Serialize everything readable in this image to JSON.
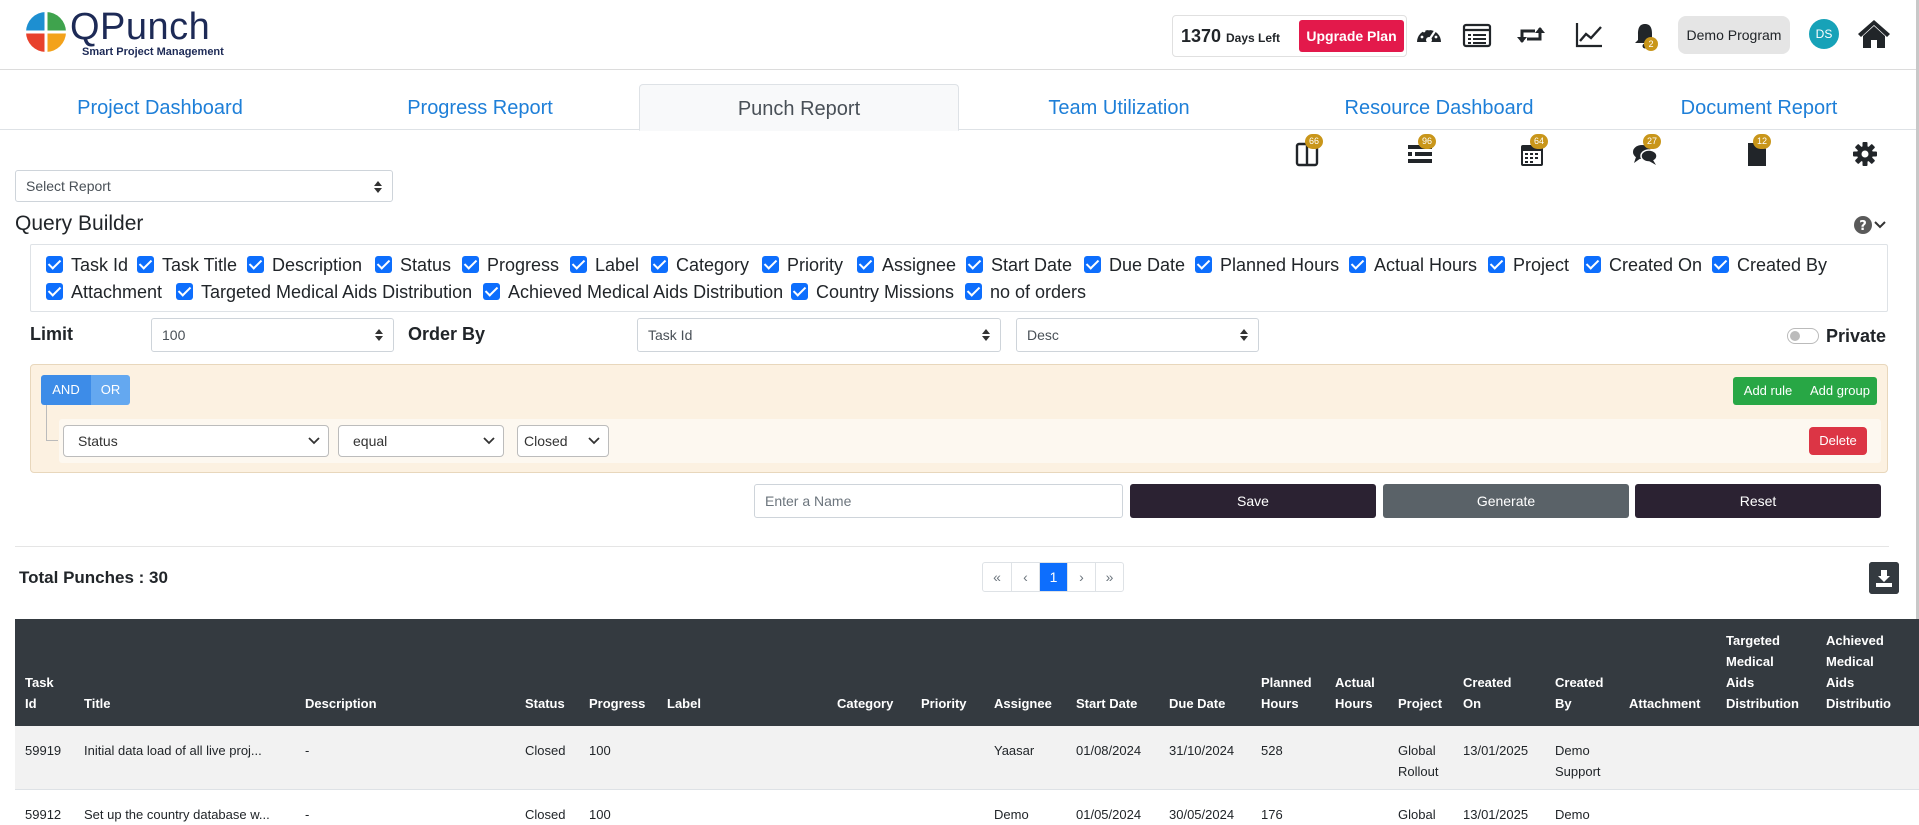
{
  "brand": {
    "name": "QPunch",
    "tagline": "Smart Project Management"
  },
  "header": {
    "days_left_num": "1370",
    "days_left_label": "Days Left",
    "upgrade_label": "Upgrade Plan",
    "notification_count": "2",
    "program_label": "Demo Program",
    "avatar_initials": "DS",
    "icons": [
      "dashboard-gauge-icon",
      "list-icon",
      "retweet-icon",
      "line-chart-icon",
      "bell-icon",
      "home-icon"
    ]
  },
  "tabs": [
    {
      "label": "Project Dashboard",
      "active": false
    },
    {
      "label": "Progress Report",
      "active": false
    },
    {
      "label": "Punch Report",
      "active": true
    },
    {
      "label": "Team Utilization",
      "active": false
    },
    {
      "label": "Resource Dashboard",
      "active": false
    },
    {
      "label": "Document Report",
      "active": false
    }
  ],
  "toolbar": {
    "badges": [
      "66",
      "96",
      "64",
      "27",
      "12"
    ],
    "icons": [
      "columns-icon",
      "stacked-list-icon",
      "calendar-icon",
      "comments-icon",
      "file-icon",
      "gear-icon"
    ]
  },
  "select_report": {
    "value": "Select Report"
  },
  "query_builder": {
    "title": "Query Builder",
    "fields": [
      "Task Id",
      "Task Title",
      "Description",
      "Status",
      "Progress",
      "Label",
      "Category",
      "Priority",
      "Assignee",
      "Start Date",
      "Due Date",
      "Planned Hours",
      "Actual Hours",
      "Project",
      "Created On",
      "Created By",
      "Attachment",
      "Targeted Medical Aids Distribution",
      "Achieved Medical Aids Distribution",
      "Country Missions",
      "no of orders"
    ],
    "limit_label": "Limit",
    "limit_value": "100",
    "order_by_label": "Order By",
    "order_by_value": "Task Id",
    "order_dir_value": "Desc",
    "private_label": "Private"
  },
  "rules": {
    "and_label": "AND",
    "or_label": "OR",
    "add_rule_label": "Add rule",
    "add_group_label": "Add group",
    "rule_field": "Status",
    "rule_operator": "equal",
    "rule_value": "Closed",
    "delete_label": "Delete"
  },
  "actions": {
    "name_placeholder": "Enter a Name",
    "save_label": "Save",
    "generate_label": "Generate",
    "reset_label": "Reset"
  },
  "results": {
    "total_label": "Total Punches : 30",
    "pager": [
      "«",
      "‹",
      "1",
      "›",
      "»"
    ],
    "current_page": "1"
  },
  "table": {
    "columns": [
      [
        "Task",
        "Id"
      ],
      [
        "Title"
      ],
      [
        "Description"
      ],
      [
        "Status"
      ],
      [
        "Progress"
      ],
      [
        "Label"
      ],
      [
        "Category"
      ],
      [
        "Priority"
      ],
      [
        "Assignee"
      ],
      [
        "Start Date"
      ],
      [
        "Due Date"
      ],
      [
        "Planned",
        "Hours"
      ],
      [
        "Actual",
        "Hours"
      ],
      [
        "Project"
      ],
      [
        "Created",
        "On"
      ],
      [
        "Created",
        "By"
      ],
      [
        "Attachment"
      ],
      [
        "Targeted",
        "Medical",
        "Aids",
        "Distribution"
      ],
      [
        "Achieved",
        "Medical",
        "Aids",
        "Distributio"
      ]
    ],
    "rows": [
      [
        "59919",
        "Initial data load of all live proj...",
        "-",
        "Closed",
        "100",
        "",
        "",
        "",
        "Yaasar",
        "01/08/2024",
        "31/10/2024",
        "528",
        "",
        "Global\nRollout",
        "13/01/2025",
        "Demo\nSupport",
        "",
        "",
        ""
      ],
      [
        "59912",
        "Set up the country database w...",
        "-",
        "Closed",
        "100",
        "",
        "",
        "",
        "Demo",
        "01/05/2024",
        "30/05/2024",
        "176",
        "",
        "Global",
        "13/01/2025",
        "Demo",
        "",
        "",
        ""
      ]
    ]
  },
  "colors": {
    "link_blue": "#1e7fd8",
    "upgrade_red": "#e3194b",
    "badge_gold": "#c9961a",
    "checkbox_blue": "#0d6efd",
    "rule_panel": "#fcf1e1",
    "add_green": "#28a745",
    "delete_red": "#dc3545",
    "save_dark": "#2b2232",
    "generate_gray": "#5a6268",
    "table_header": "#343a40"
  }
}
